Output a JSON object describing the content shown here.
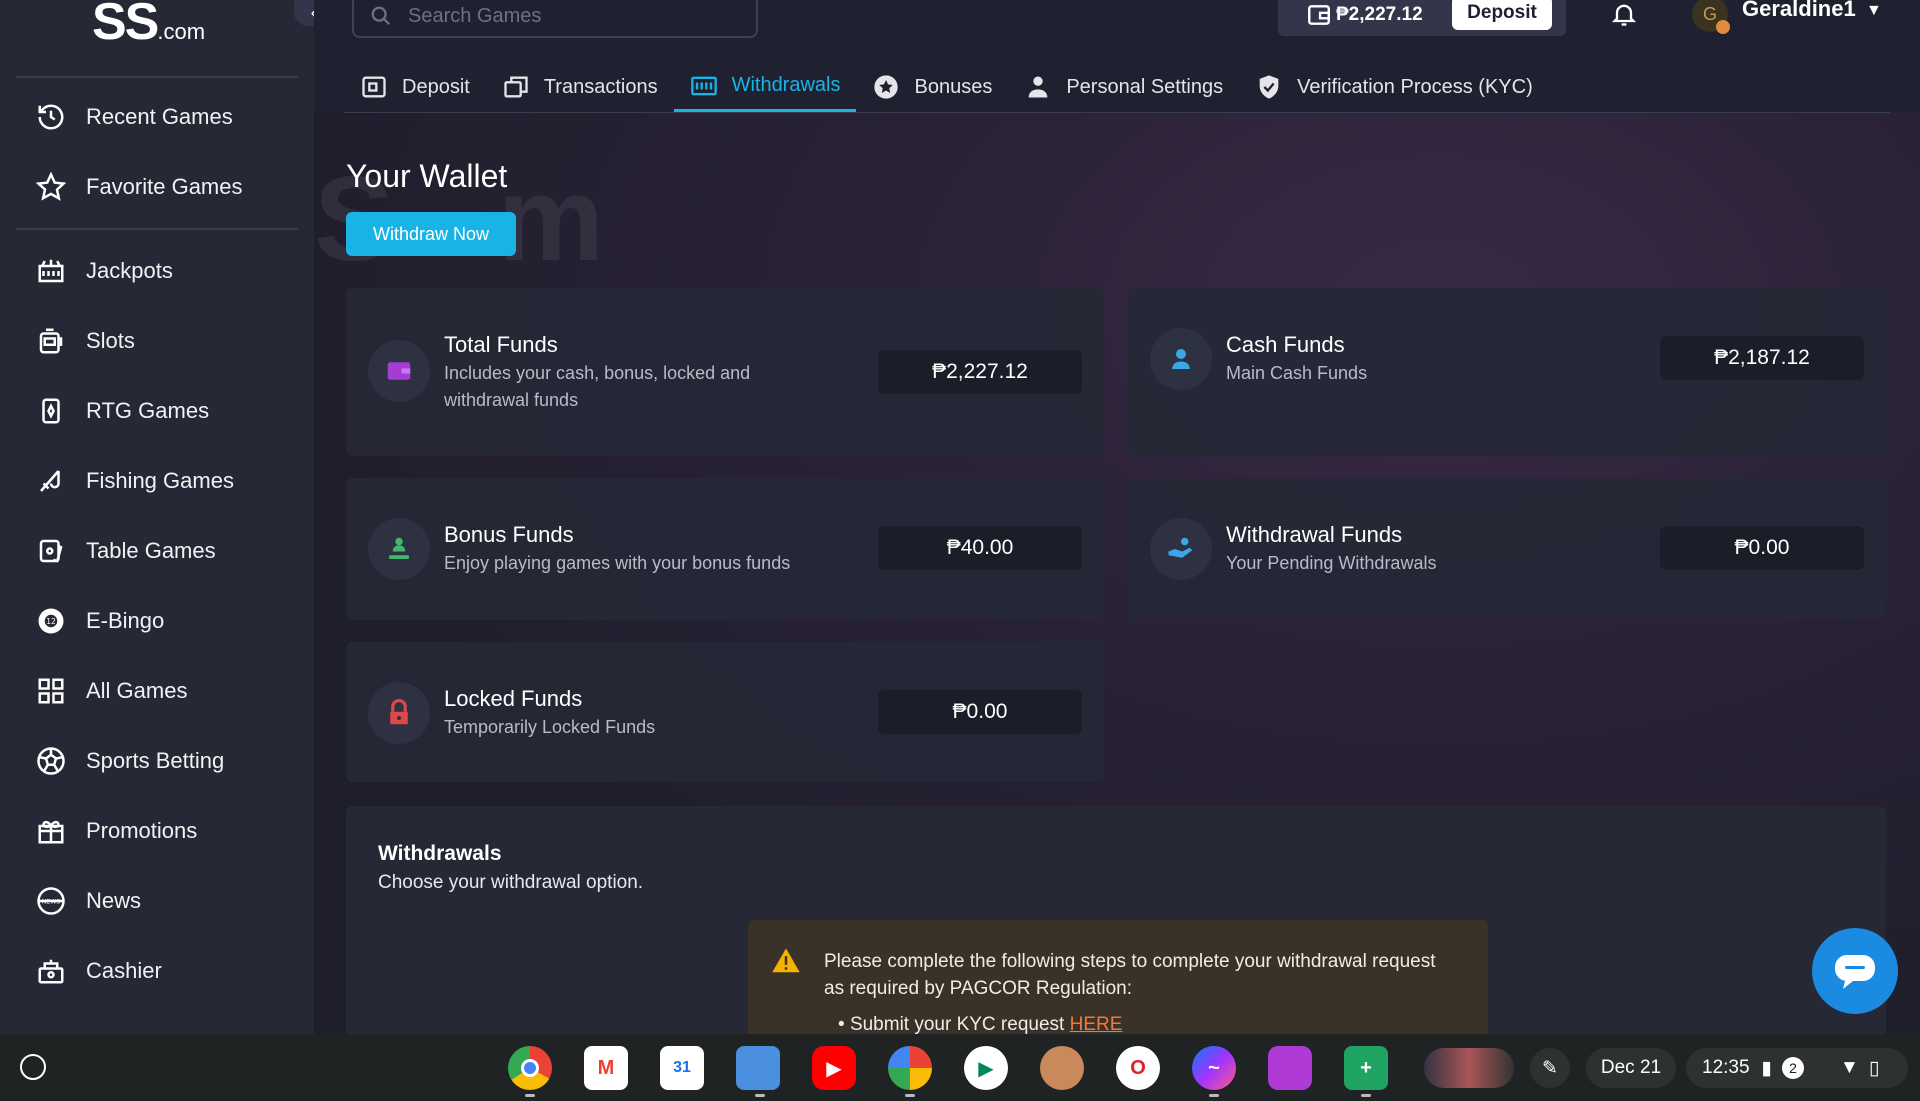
{
  "brand": {
    "logo_main": "SS",
    "logo_suffix": ".com"
  },
  "sidebar": {
    "items": [
      {
        "label": "Recent Games",
        "icon": "history-icon"
      },
      {
        "label": "Favorite Games",
        "icon": "star-icon"
      },
      {
        "label": "Jackpots",
        "icon": "jackpot-icon"
      },
      {
        "label": "Slots",
        "icon": "slot-machine-icon"
      },
      {
        "label": "RTG Games",
        "icon": "cards-icon"
      },
      {
        "label": "Fishing Games",
        "icon": "fishing-icon"
      },
      {
        "label": "Table Games",
        "icon": "table-games-icon"
      },
      {
        "label": "E-Bingo",
        "icon": "bingo-ball-icon"
      },
      {
        "label": "All Games",
        "icon": "grid-icon"
      },
      {
        "label": "Sports Betting",
        "icon": "soccer-ball-icon"
      },
      {
        "label": "Promotions",
        "icon": "gift-icon"
      },
      {
        "label": "News",
        "icon": "news-icon"
      },
      {
        "label": "Cashier",
        "icon": "cashier-icon"
      }
    ]
  },
  "header": {
    "search_placeholder": "Search Games",
    "balance": "₱2,227.12",
    "deposit_label": "Deposit",
    "username": "Geraldine1",
    "avatar_initial": "G"
  },
  "tabs": [
    {
      "label": "Deposit",
      "icon": "wallet-icon"
    },
    {
      "label": "Transactions",
      "icon": "transactions-icon"
    },
    {
      "label": "Withdrawals",
      "icon": "atm-icon",
      "active": true
    },
    {
      "label": "Bonuses",
      "icon": "star-badge-icon"
    },
    {
      "label": "Personal Settings",
      "icon": "user-icon"
    },
    {
      "label": "Verification Process (KYC)",
      "icon": "shield-check-icon"
    }
  ],
  "wallet": {
    "title": "Your Wallet",
    "withdraw_now_label": "Withdraw Now",
    "cards": {
      "total": {
        "title": "Total Funds",
        "subtitle": "Includes your cash, bonus, locked and withdrawal funds",
        "value": "₱2,227.12"
      },
      "cash": {
        "title": "Cash Funds",
        "subtitle": "Main Cash Funds",
        "value": "₱2,187.12"
      },
      "bonus": {
        "title": "Bonus Funds",
        "subtitle": "Enjoy playing games with your bonus funds",
        "value": "₱40.00"
      },
      "withdrawal": {
        "title": "Withdrawal Funds",
        "subtitle": "Your Pending Withdrawals",
        "value": "₱0.00"
      },
      "locked": {
        "title": "Locked Funds",
        "subtitle": "Temporarily Locked Funds",
        "value": "₱0.00"
      }
    }
  },
  "withdrawals": {
    "title": "Withdrawals",
    "subtitle": "Choose your withdrawal option.",
    "alert_text": "Please complete the following steps to complete your withdrawal request as required by PAGCOR Regulation:",
    "alert_item": "Submit your KYC request",
    "alert_link": "HERE"
  },
  "taskbar": {
    "date": "Dec 21",
    "time": "12:35",
    "notification_count": "2",
    "apps": [
      "chrome-icon",
      "gmail-icon",
      "calendar-icon",
      "files-icon",
      "youtube-icon",
      "photos-icon",
      "play-store-icon",
      "app-icon",
      "opera-icon",
      "messenger-icon",
      "app-icon",
      "sheets-icon"
    ],
    "calendar_day": "31"
  },
  "colors": {
    "accent": "#1ab3e6",
    "background": "#1f2130",
    "alert_link": "#f07a3a"
  }
}
